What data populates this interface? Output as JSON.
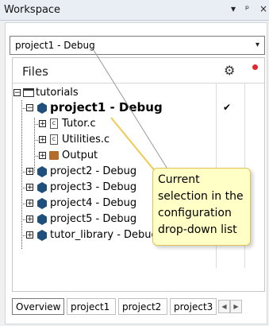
{
  "window": {
    "title": "Workspace",
    "menu_glyph": "▾",
    "pin_glyph": "ᵖ",
    "close_glyph": "×"
  },
  "configuration": {
    "selected": "project1 - Debug",
    "arrow": "▾"
  },
  "files_header": {
    "label": "Files",
    "options_icon": "⚙"
  },
  "tree": {
    "root": {
      "label": "tutorials"
    },
    "project1": {
      "label": "project1 - Debug",
      "check": "✔"
    },
    "files": [
      {
        "label": "Tutor.c"
      },
      {
        "label": "Utilities.c"
      }
    ],
    "output": {
      "label": "Output"
    },
    "projects": [
      {
        "label": "project2 - Debug"
      },
      {
        "label": "project3 - Debug"
      },
      {
        "label": "project4 - Debug"
      },
      {
        "label": "project5 - Debug"
      },
      {
        "label": "tutor_library - Debug",
        "check": "✔"
      }
    ]
  },
  "tabs": [
    {
      "label": "Overview"
    },
    {
      "label": "project1"
    },
    {
      "label": "project2"
    },
    {
      "label": "project3"
    }
  ],
  "tooltip": {
    "lines": [
      "Current",
      "selection in the",
      "configuration",
      "drop-down list"
    ]
  }
}
